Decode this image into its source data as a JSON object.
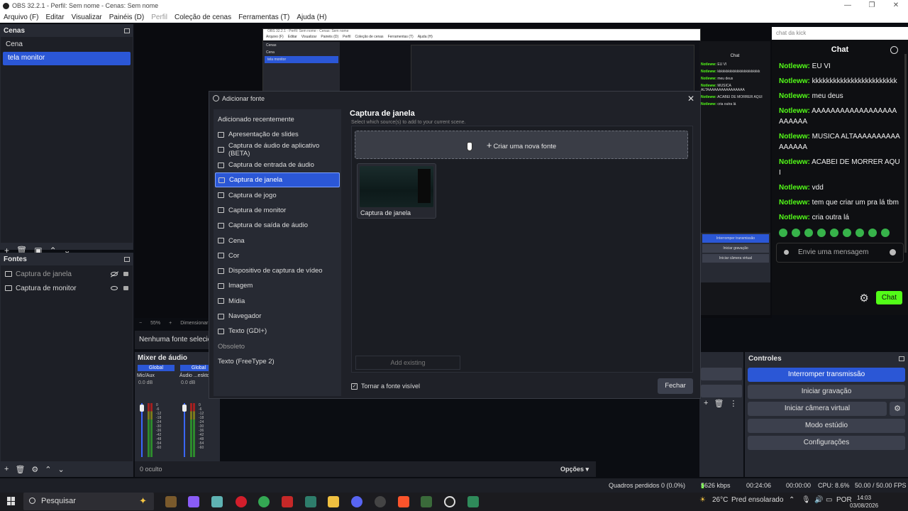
{
  "window": {
    "title": "OBS 32.2.1 - Perfil: Sem nome - Cenas: Sem nome",
    "min": "—",
    "max": "❐",
    "close": "✕"
  },
  "menu": [
    "Arquivo (F)",
    "Editar",
    "Visualizar",
    "Painéis (D)",
    "Perfil",
    "Coleção de cenas",
    "Ferramentas (T)",
    "Ajuda (H)"
  ],
  "scenes": {
    "title": "Cenas",
    "items": [
      "Cena",
      "tela monitor"
    ],
    "selected": "tela monitor"
  },
  "sources": {
    "title": "Fontes",
    "items": [
      {
        "label": "Captura de janela",
        "visible": false
      },
      {
        "label": "Captura de monitor",
        "visible": true
      }
    ]
  },
  "preview": {
    "zoom": "55%",
    "scale_label": "Dimensionar",
    "no_source": "Nenhuma fonte selecionada"
  },
  "mixer": {
    "title": "Mixer de áudio",
    "channels": [
      {
        "group": "Global",
        "name": "Mic/Aux",
        "db": "0.0 dB"
      },
      {
        "group": "Global",
        "name": "Áudio ...esktop",
        "db": "0.0 dB"
      }
    ],
    "scale": [
      "0",
      "-6",
      "-12",
      "-18",
      "-24",
      "-30",
      "-36",
      "-42",
      "-48",
      "-54",
      "-60"
    ],
    "hidden": "0 oculto",
    "options": "Opções"
  },
  "controls": {
    "title": "Controles",
    "buttons": [
      "Interromper transmissão",
      "Iniciar gravação",
      "Iniciar câmera virtual",
      "Modo estúdio",
      "Configurações"
    ]
  },
  "chat": {
    "url": "chat da kick",
    "title": "Chat",
    "messages": [
      {
        "user": "Notleww:",
        "text": "EU VI"
      },
      {
        "user": "Notleww:",
        "text": "kkkkkkkkkkkkkkkkkkkkkkkk"
      },
      {
        "user": "Notleww:",
        "text": "meu deus"
      },
      {
        "user": "Notleww:",
        "text": "AAAAAAAAAAAAAAAAAAAAAAAA"
      },
      {
        "user": "Notleww:",
        "text": "MUSICA ALTAAAAAAAAAAAAAAAA"
      },
      {
        "user": "Notleww:",
        "text": "ACABEI DE MORRER AQUI"
      },
      {
        "user": "Notleww:",
        "text": "vdd"
      },
      {
        "user": "Notleww:",
        "text": "tem que criar um pra lá tbm"
      },
      {
        "user": "Notleww:",
        "text": "cria outra lá"
      }
    ],
    "input_placeholder": "Envie uma mensagem",
    "send": "Chat",
    "accent": "#53fc18"
  },
  "modal": {
    "title": "Adicionar fonte",
    "close": "✕",
    "list_header": "Adicionado recentemente",
    "items": [
      "Apresentação de slides",
      "Captura de áudio de aplicativo (BETA)",
      "Captura de entrada de áudio",
      "Captura de janela",
      "Captura de jogo",
      "Captura de monitor",
      "Captura de saída de áudio",
      "Cena",
      "Cor",
      "Dispositivo de captura de vídeo",
      "Imagem",
      "Mídia",
      "Navegador",
      "Texto (GDI+)"
    ],
    "selected": "Captura de janela",
    "obsolete_header": "Obsoleto",
    "obsolete_items": [
      "Texto (FreeType 2)"
    ],
    "right_title": "Captura de janela",
    "right_sub": "Select which source(s) to add to your current scene.",
    "new_source": "Criar uma nova fonte",
    "existing": "Captura de janela",
    "add_existing": "Add existing",
    "visible_check": "Tornar a fonte visível",
    "close_btn": "Fechar"
  },
  "status": {
    "dropped": "Quadros perdidos 0 (0.0%)",
    "bitrate": "5626 kbps",
    "stream_time": "00:24:06",
    "rec_time": "00:00:00",
    "cpu": "CPU: 8.6%",
    "fps": "50.00 / 50.00 FPS"
  },
  "taskbar": {
    "search": "Pesquisar",
    "weather": "26°C",
    "weather_desc": "Pred ensolarado",
    "lang": "POR",
    "time": "14:03",
    "date": "03/08/2026"
  },
  "brand": {
    "accent": "#2b57d6"
  }
}
